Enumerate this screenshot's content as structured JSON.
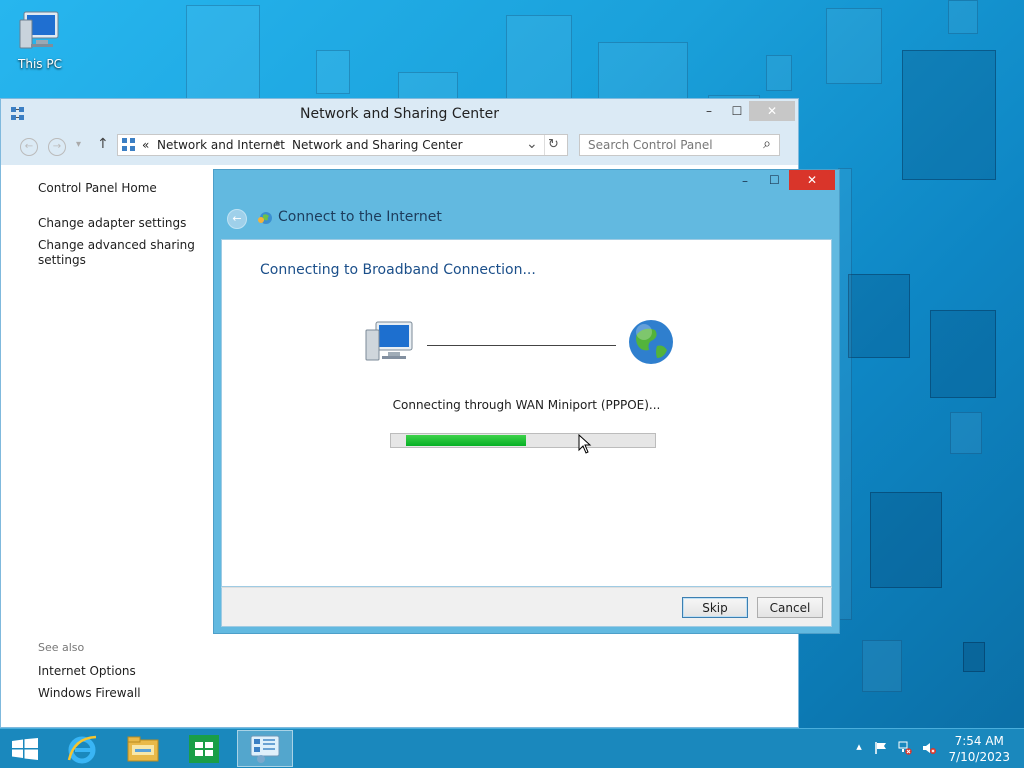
{
  "desktop": {
    "icon_label": "This PC"
  },
  "main_window": {
    "title": "Network and Sharing Center",
    "minimize_glyph": "–",
    "maximize_glyph": "☐",
    "close_glyph": "✕",
    "nav": {
      "back_glyph": "←",
      "forward_glyph": "→",
      "recent_glyph": "▾",
      "up_glyph": "↑"
    },
    "address": {
      "chevron": "«",
      "crumbs": [
        "Network and Internet",
        "Network and Sharing Center"
      ],
      "separator": "▸",
      "dropdown_glyph": "⌄",
      "refresh_glyph": "↻"
    },
    "search": {
      "placeholder": "Search Control Panel",
      "icon_glyph": "⌕"
    },
    "left_pane": {
      "home": "Control Panel Home",
      "links": [
        "Change adapter settings",
        "Change advanced sharing settings"
      ]
    },
    "see_also": {
      "heading": "See also",
      "links": [
        "Internet Options",
        "Windows Firewall"
      ]
    }
  },
  "dialog": {
    "title": "Connect to the Internet",
    "minimize_glyph": "–",
    "maximize_glyph": "☐",
    "close_glyph": "✕",
    "back_glyph": "←",
    "heading": "Connecting to Broadband Connection...",
    "status": "Connecting through WAN Miniport (PPPOE)...",
    "progress_fraction": 0.48,
    "buttons": {
      "skip": "Skip",
      "cancel": "Cancel"
    }
  },
  "taskbar": {
    "apps": [
      {
        "name": "start-button",
        "icon": "windows-logo-icon"
      },
      {
        "name": "internet-explorer",
        "icon": "ie-icon"
      },
      {
        "name": "file-explorer",
        "icon": "folder-icon"
      },
      {
        "name": "store",
        "icon": "store-icon"
      },
      {
        "name": "control-panel",
        "icon": "control-panel-icon",
        "active": true
      }
    ],
    "tray_up_glyph": "▴",
    "clock": {
      "time": "7:54 AM",
      "date": "7/10/2023"
    }
  },
  "colors": {
    "desktop_bg": "#1aa0da",
    "dialog_frame": "#62b9e0",
    "heading_blue": "#1b4f8a",
    "progress_green": "#06b025",
    "close_red": "#d9352a"
  }
}
